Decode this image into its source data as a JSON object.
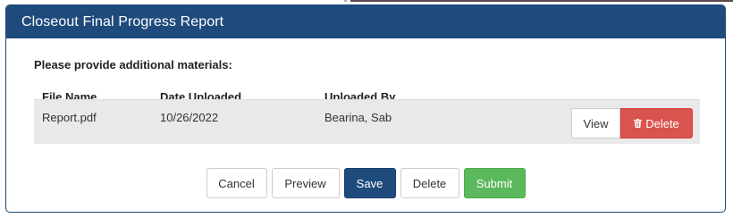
{
  "dialog": {
    "title": "Closeout Final Progress Report"
  },
  "materials": {
    "prompt": "Please provide additional materials:",
    "columns": {
      "file_name": "File Name",
      "date_uploaded": "Date Uploaded",
      "uploaded_by": "Uploaded By"
    },
    "rows": [
      {
        "file_name": "Report.pdf",
        "date_uploaded": "10/26/2022",
        "uploaded_by": "Bearina, Sab",
        "view_label": "View",
        "delete_label": "Delete",
        "delete_icon": "trash-icon"
      }
    ]
  },
  "footer": {
    "cancel_label": "Cancel",
    "preview_label": "Preview",
    "save_label": "Save",
    "delete_label": "Delete",
    "submit_label": "Submit"
  },
  "colors": {
    "header_bg": "#1f4a7c",
    "save_bg": "#1f4a7c",
    "delete_bg": "#d9534f",
    "submit_bg": "#5cb85c",
    "row_bg": "#e9e9e9"
  }
}
